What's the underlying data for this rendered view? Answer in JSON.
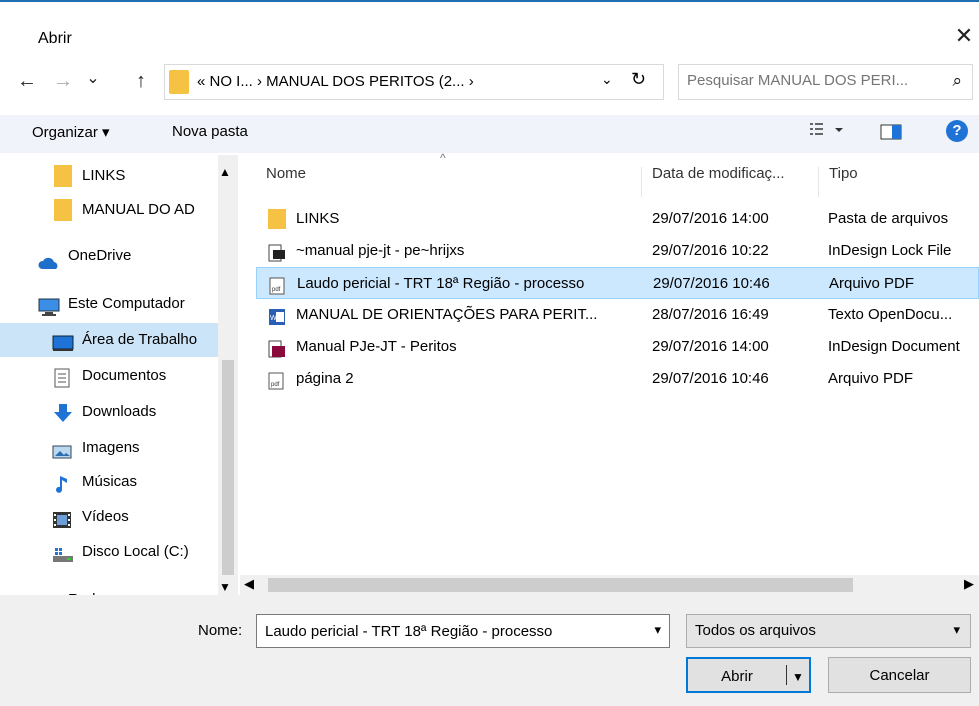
{
  "window": {
    "title": "Abrir",
    "close_icon": "close-icon"
  },
  "nav": {
    "back_icon": "←",
    "forward_icon": "→",
    "recent_icon": "⌄",
    "up_icon": "↑",
    "breadcrumb": "« NO I...  ›  MANUAL DOS PERITOS (2...  ›",
    "refresh_icon": "↻",
    "dropdown_icon": "⌄"
  },
  "search": {
    "placeholder": "Pesquisar MANUAL DOS PERI...",
    "icon": "⌕"
  },
  "toolbar": {
    "organize_label": "Organizar ▾",
    "new_folder_label": "Nova pasta",
    "help_label": "?"
  },
  "sidebar": {
    "items": [
      {
        "label": "LINKS",
        "icon": "folder-icon"
      },
      {
        "label": "MANUAL DO AD",
        "icon": "folder-icon"
      },
      {
        "label": "OneDrive",
        "icon": "cloud-icon"
      },
      {
        "label": "Este Computador",
        "icon": "computer-icon"
      },
      {
        "label": "Área de Trabalho",
        "icon": "desktop-icon"
      },
      {
        "label": "Documentos",
        "icon": "documents-icon"
      },
      {
        "label": "Downloads",
        "icon": "downloads-icon"
      },
      {
        "label": "Imagens",
        "icon": "pictures-icon"
      },
      {
        "label": "Músicas",
        "icon": "music-icon"
      },
      {
        "label": "Vídeos",
        "icon": "videos-icon"
      },
      {
        "label": "Disco Local (C:)",
        "icon": "drive-icon"
      },
      {
        "label": "Rede",
        "icon": "network-icon"
      }
    ]
  },
  "columns": {
    "name": "Nome",
    "date": "Data de modificaç...",
    "type": "Tipo"
  },
  "files": [
    {
      "name": "LINKS",
      "date": "29/07/2016 14:00",
      "type": "Pasta de arquivos",
      "icon": "folder-icon"
    },
    {
      "name": "~manual pje-jt - pe~hrijxs",
      "date": "29/07/2016 10:22",
      "type": "InDesign Lock File",
      "icon": "lock-file-icon"
    },
    {
      "name": "Laudo pericial - TRT 18ª Região - processo",
      "date": "29/07/2016 10:46",
      "type": "Arquivo PDF",
      "icon": "pdf-icon"
    },
    {
      "name": "MANUAL DE ORIENTAÇÕES PARA PERIT...",
      "date": "28/07/2016 16:49",
      "type": "Texto OpenDocu...",
      "icon": "odt-icon"
    },
    {
      "name": "Manual PJe-JT - Peritos",
      "date": "29/07/2016 14:00",
      "type": "InDesign Document",
      "icon": "indesign-icon"
    },
    {
      "name": "página 2",
      "date": "29/07/2016 10:46",
      "type": "Arquivo PDF",
      "icon": "pdf-icon"
    }
  ],
  "bottom": {
    "name_label": "Nome:",
    "name_value": "Laudo pericial - TRT 18ª Região - processo",
    "type_value": "Todos os arquivos",
    "open_label": "Abrir",
    "cancel_label": "Cancelar"
  }
}
